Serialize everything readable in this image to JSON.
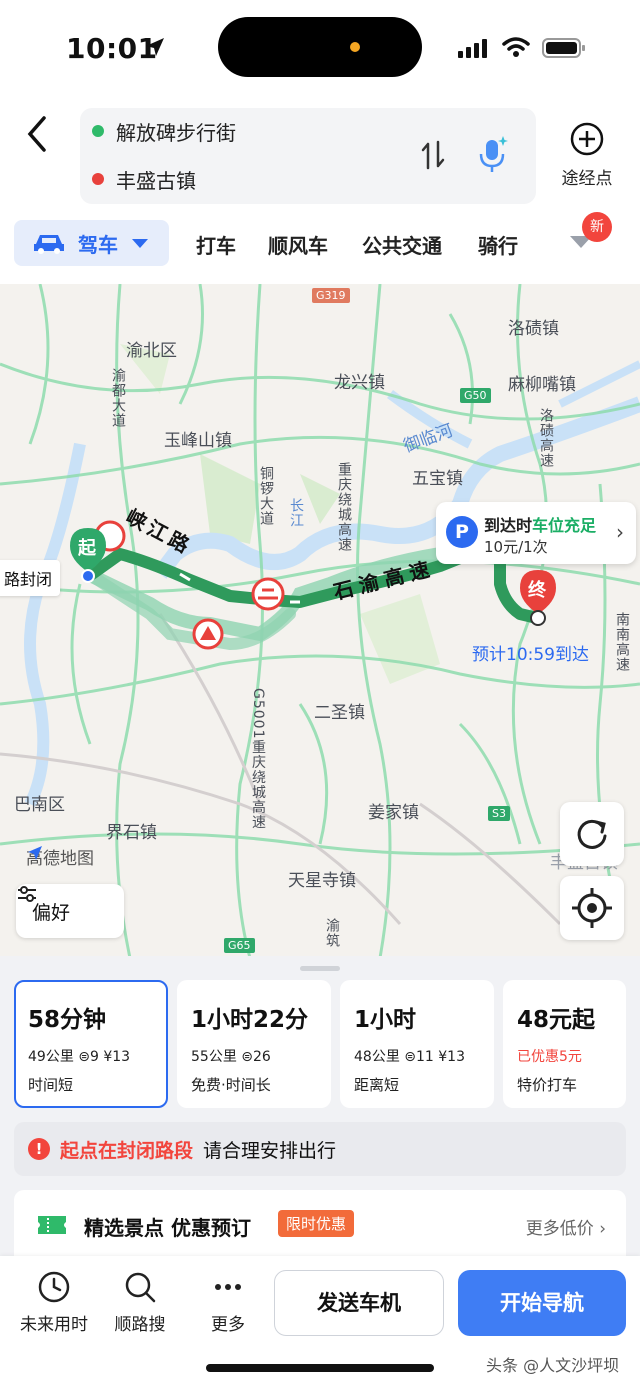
{
  "status_bar": {
    "time": "10:01"
  },
  "header": {
    "start": "解放碑步行街",
    "end": "丰盛古镇",
    "via_label": "途经点"
  },
  "modes": {
    "selected": "驾车",
    "items": [
      "打车",
      "顺风车",
      "公共交通",
      "骑行"
    ],
    "new_badge": "新"
  },
  "map": {
    "labels": {
      "yubei": "渝北区",
      "yufeng": "玉峰山镇",
      "longxing": "龙兴镇",
      "luoqi": "洛碛镇",
      "maliuzui": "麻柳嘴镇",
      "yulinhe": "御临河",
      "wubao": "五宝镇",
      "ersheng": "二圣镇",
      "jiangjia": "姜家镇",
      "banan": "巴南区",
      "jieshi": "界石镇",
      "tianxingsi": "天星寺镇",
      "yudu": "渝都大道",
      "tongluo": "铜锣大道",
      "changjiang": "长江",
      "chongqing_ring": "重庆绕城高速",
      "shiyu_hw": "石渝高速",
      "nannan": "南南高速",
      "g5001": "G5001重庆绕城高速",
      "yuzhu": "渝筑",
      "fengsheng_partial": "丰盛古镇",
      "luoxia": "洛碛高速"
    },
    "shields": {
      "g319": "G319",
      "g50": "G50",
      "s3": "S3",
      "g65": "G65"
    },
    "route_names": {
      "xiajiang": "峡江路",
      "shiyu": "石渝高速"
    },
    "start_marker": "起",
    "end_marker": "终",
    "closed_tag": "路封闭",
    "parking": {
      "title_prefix": "到达时",
      "title_status": "车位充足",
      "price": "10元/1次",
      "icon": "P"
    },
    "eta": "预计10:59到达",
    "brand": "高德地图",
    "preference": "偏好",
    "colors": {
      "route": "#2f9a5c",
      "route_alt": "#8fd3b0",
      "roads": "#8fdcae",
      "water": "#c9e1f7"
    }
  },
  "route_options": [
    {
      "time": "58分钟",
      "meta": "49公里 ⊜9 ¥13",
      "sub": "时间短",
      "selected": true
    },
    {
      "time": "1小时22分",
      "meta": "55公里 ⊜26",
      "sub": "免费·时间长",
      "selected": false
    },
    {
      "time": "1小时",
      "meta": "48公里 ⊜11 ¥13",
      "sub": "距离短",
      "selected": false
    },
    {
      "time": "48元起",
      "meta": "已优惠5元",
      "sub": "特价打车",
      "selected": false
    }
  ],
  "alert": {
    "icon": "!",
    "highlight": "起点在封闭路段",
    "text": "请合理安排出行"
  },
  "promo": {
    "title": "精选景点 优惠预订",
    "tag": "限时优惠",
    "more": "更多低价 ›"
  },
  "bottom_bar": {
    "future": "未来用时",
    "along": "顺路搜",
    "more": "更多",
    "send": "发送车机",
    "start": "开始导航"
  },
  "watermark": "头条 @人文沙坪坝"
}
